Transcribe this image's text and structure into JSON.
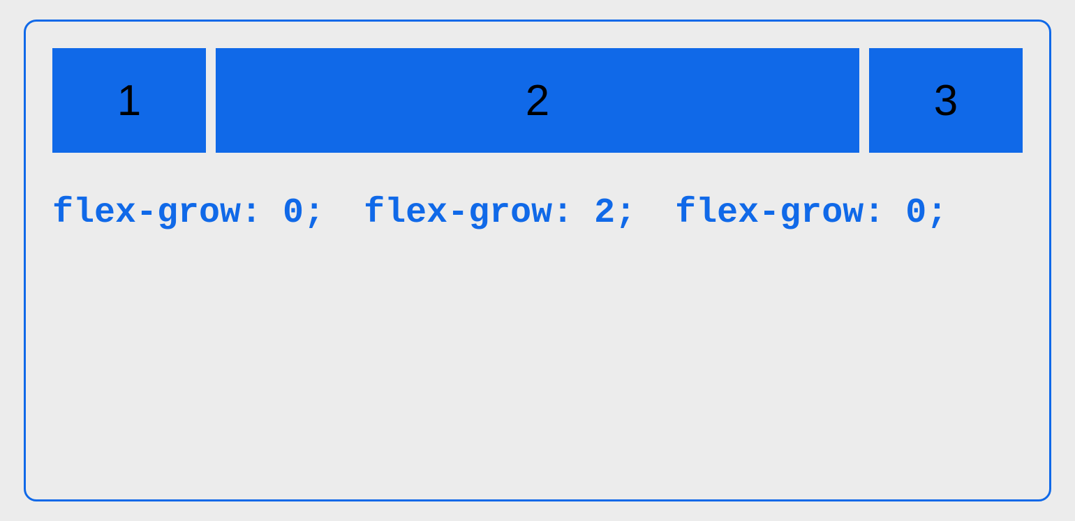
{
  "boxes": {
    "item1": "1",
    "item2": "2",
    "item3": "3"
  },
  "labels": {
    "label1": "flex-grow: 0;",
    "label2": "flex-grow: 2;",
    "label3": "flex-grow: 0;"
  },
  "colors": {
    "accent": "#1069e8",
    "background": "#ececec"
  }
}
